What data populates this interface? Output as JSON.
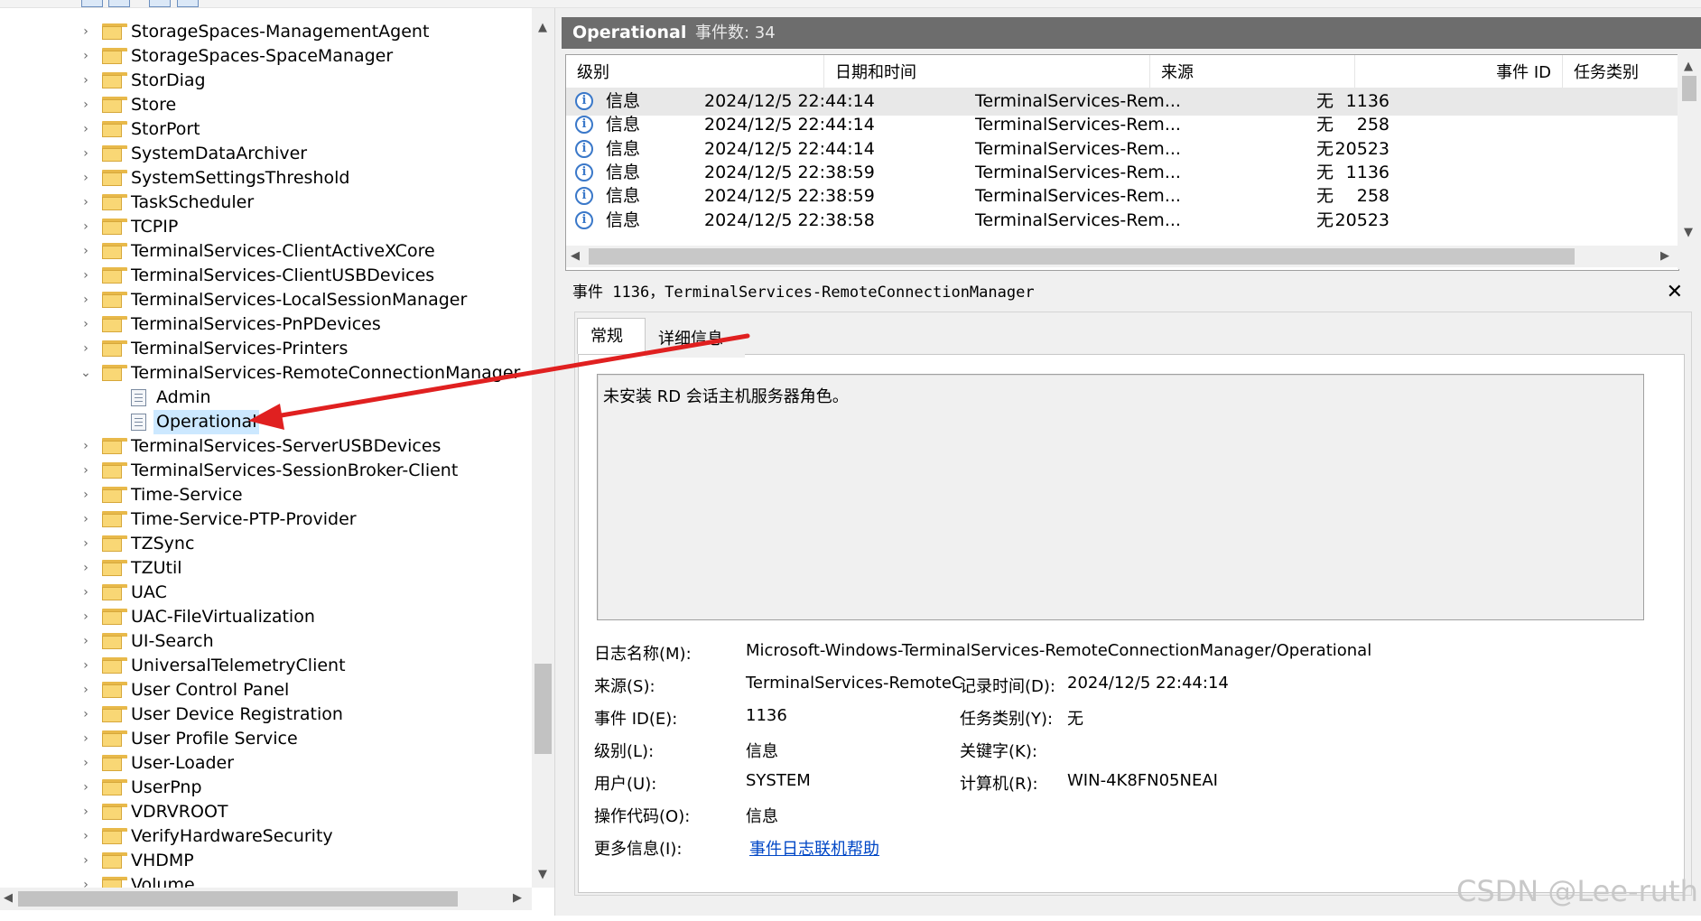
{
  "tree": {
    "items": [
      {
        "label": "StorageSpaces-ManagementAgent",
        "expanded": false
      },
      {
        "label": "StorageSpaces-SpaceManager",
        "expanded": false
      },
      {
        "label": "StorDiag",
        "expanded": false
      },
      {
        "label": "Store",
        "expanded": false
      },
      {
        "label": "StorPort",
        "expanded": false
      },
      {
        "label": "SystemDataArchiver",
        "expanded": false
      },
      {
        "label": "SystemSettingsThreshold",
        "expanded": false
      },
      {
        "label": "TaskScheduler",
        "expanded": false
      },
      {
        "label": "TCPIP",
        "expanded": false
      },
      {
        "label": "TerminalServices-ClientActiveXCore",
        "expanded": false
      },
      {
        "label": "TerminalServices-ClientUSBDevices",
        "expanded": false
      },
      {
        "label": "TerminalServices-LocalSessionManager",
        "expanded": false
      },
      {
        "label": "TerminalServices-PnPDevices",
        "expanded": false
      },
      {
        "label": "TerminalServices-Printers",
        "expanded": false
      },
      {
        "label": "TerminalServices-RemoteConnectionManager",
        "expanded": true
      },
      {
        "label": "Admin",
        "child": true
      },
      {
        "label": "Operational",
        "child": true,
        "selected": true
      },
      {
        "label": "TerminalServices-ServerUSBDevices",
        "expanded": false
      },
      {
        "label": "TerminalServices-SessionBroker-Client",
        "expanded": false
      },
      {
        "label": "Time-Service",
        "expanded": false
      },
      {
        "label": "Time-Service-PTP-Provider",
        "expanded": false
      },
      {
        "label": "TZSync",
        "expanded": false
      },
      {
        "label": "TZUtil",
        "expanded": false
      },
      {
        "label": "UAC",
        "expanded": false
      },
      {
        "label": "UAC-FileVirtualization",
        "expanded": false
      },
      {
        "label": "UI-Search",
        "expanded": false
      },
      {
        "label": "UniversalTelemetryClient",
        "expanded": false
      },
      {
        "label": "User Control Panel",
        "expanded": false
      },
      {
        "label": "User Device Registration",
        "expanded": false
      },
      {
        "label": "User Profile Service",
        "expanded": false
      },
      {
        "label": "User-Loader",
        "expanded": false
      },
      {
        "label": "UserPnp",
        "expanded": false
      },
      {
        "label": "VDRVROOT",
        "expanded": false
      },
      {
        "label": "VerifyHardwareSecurity",
        "expanded": false
      },
      {
        "label": "VHDMP",
        "expanded": false
      },
      {
        "label": "Volume",
        "expanded": false
      }
    ]
  },
  "list": {
    "title": "Operational",
    "count_label": "事件数: 34",
    "columns": [
      "级别",
      "日期和时间",
      "来源",
      "事件 ID",
      "任务类别"
    ],
    "rows": [
      {
        "level": "信息",
        "datetime": "2024/12/5 22:44:14",
        "source": "TerminalServices-Rem...",
        "event_id": "1136",
        "category": "无"
      },
      {
        "level": "信息",
        "datetime": "2024/12/5 22:44:14",
        "source": "TerminalServices-Rem...",
        "event_id": "258",
        "category": "无"
      },
      {
        "level": "信息",
        "datetime": "2024/12/5 22:44:14",
        "source": "TerminalServices-Rem...",
        "event_id": "20523",
        "category": "无"
      },
      {
        "level": "信息",
        "datetime": "2024/12/5 22:38:59",
        "source": "TerminalServices-Rem...",
        "event_id": "1136",
        "category": "无"
      },
      {
        "level": "信息",
        "datetime": "2024/12/5 22:38:59",
        "source": "TerminalServices-Rem...",
        "event_id": "258",
        "category": "无"
      },
      {
        "level": "信息",
        "datetime": "2024/12/5 22:38:58",
        "source": "TerminalServices-Rem...",
        "event_id": "20523",
        "category": "无"
      }
    ]
  },
  "detail": {
    "title": "事件 1136，TerminalServices-RemoteConnectionManager",
    "tabs": [
      "常规",
      "详细信息"
    ],
    "message": "未安装 RD 会话主机服务器角色。",
    "props": {
      "log_name_label": "日志名称(M):",
      "log_name": "Microsoft-Windows-TerminalServices-RemoteConnectionManager/Operational",
      "source_label": "来源(S):",
      "source": "TerminalServices-RemoteC",
      "logged_label": "记录时间(D):",
      "logged": "2024/12/5 22:44:14",
      "event_id_label": "事件 ID(E):",
      "event_id": "1136",
      "task_label": "任务类别(Y):",
      "task": "无",
      "level_label": "级别(L):",
      "level": "信息",
      "keywords_label": "关键字(K):",
      "keywords": "",
      "user_label": "用户(U):",
      "user": "SYSTEM",
      "computer_label": "计算机(R):",
      "computer": "WIN-4K8FN05NEAI",
      "opcode_label": "操作代码(O):",
      "opcode": "信息",
      "more_info_label": "更多信息(I):",
      "more_info_link": "事件日志联机帮助"
    }
  },
  "watermark": "CSDN @Lee-ruth",
  "colors": {
    "header_bar": "#6d6d6d",
    "selection": "#cce8ff",
    "arrow": "#e02020",
    "link": "#0047c6",
    "folder": "#f9d775"
  }
}
